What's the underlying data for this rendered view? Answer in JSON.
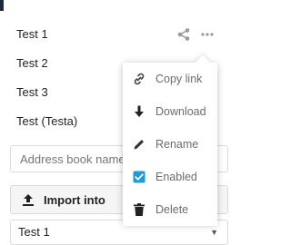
{
  "address_books": [
    {
      "name": "Test 1"
    },
    {
      "name": "Test 2"
    },
    {
      "name": "Test 3"
    },
    {
      "name": "Test (Testa)"
    }
  ],
  "new_book": {
    "placeholder": "Address book name"
  },
  "import": {
    "button_label": "Import into",
    "target": "Test 1"
  },
  "menu": {
    "items": [
      {
        "label": "Copy link",
        "icon": "link-icon"
      },
      {
        "label": "Download",
        "icon": "download-icon"
      },
      {
        "label": "Rename",
        "icon": "pencil-icon"
      },
      {
        "label": "Enabled",
        "icon": "checkbox-checked-icon",
        "checked": true
      },
      {
        "label": "Delete",
        "icon": "trash-icon"
      }
    ]
  },
  "colors": {
    "checkbox": "#1e9bd7",
    "icon": "#444444"
  }
}
